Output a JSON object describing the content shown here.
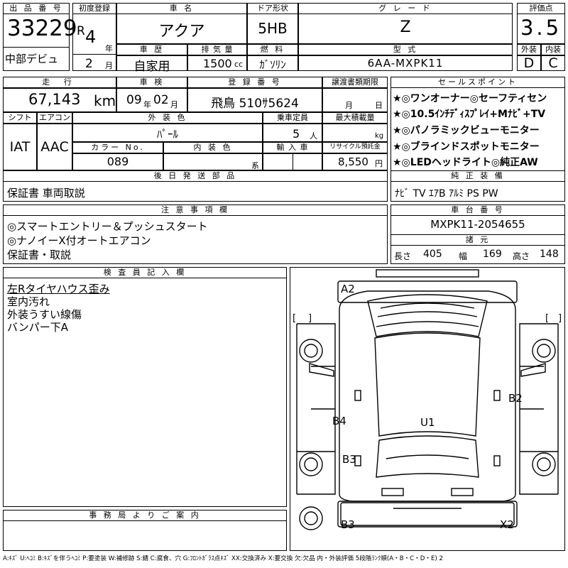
{
  "header": {
    "lot_no_label": "出 品 番 号",
    "lot_no": "33229",
    "debut_label": "中部デビュ",
    "first_reg_label": "初度登録",
    "era": "R",
    "year": "4",
    "year_unit": "年",
    "month": "2",
    "month_unit": "月",
    "car_name_label": "車   名",
    "car_name": "アクア",
    "door_label": "ドア形状",
    "door": "5HB",
    "grade_label": "グ レ ー ド",
    "grade": "Z",
    "score_label": "評価点",
    "score": "3.5",
    "history_label": "車 歴",
    "history": "自家用",
    "displacement_label": "排 気 量",
    "displacement": "1500",
    "displacement_unit": "cc",
    "fuel_label": "燃 料",
    "fuel": "ｶﾞｿﾘﾝ",
    "model_label": "型 式",
    "model": "6AA-MXPK11",
    "ext_label": "外装",
    "ext": "D",
    "int_label": "内装",
    "int": "C"
  },
  "row2": {
    "mileage_label": "走 行",
    "mileage": "67,143",
    "mileage_unit": "km",
    "inspection_label": "車 検",
    "insp_year": "09",
    "insp_year_unit": "年",
    "insp_month": "02",
    "insp_month_unit": "月",
    "reg_no_label": "登 録 番 号",
    "reg_no": "飛鳥 510ｻ5624",
    "transfer_label": "譲渡書類期限",
    "transfer_month_unit": "月",
    "transfer_day_unit": "日",
    "shift_label": "シフト",
    "shift": "IAT",
    "ac_label": "エアコン",
    "ac": "AAC",
    "ext_color_label": "外 装 色",
    "ext_color": "ﾊﾟｰﾙ",
    "capacity_label": "乗車定員",
    "capacity": "5",
    "capacity_unit": "人",
    "load_label": "最大積載量",
    "load_unit": "kg",
    "color_no_label": "カラー No.",
    "color_no": "089",
    "int_color_label": "内 装 色",
    "int_color_unit": "系",
    "import_label": "輸 入 車",
    "recycle_label": "リサイクル預託金",
    "recycle": "8,550",
    "recycle_unit": "円",
    "later_parts_label": "後 日 発 送 部 品",
    "later_parts": "保証書 車両取説"
  },
  "sales": {
    "label": "セールスポイント",
    "items": [
      "★◎ワンオーナー◎セーフティセン",
      "★◎10.5ｲﾝﾁﾃﾞｨｽﾌﾟﾚｲ+Mﾅﾋﾞ+TV",
      "★◎パノラミックビューモニター",
      "★◎ブラインドスポットモニター",
      "★◎LEDヘッドライト◎純正AW"
    ],
    "equip_label": "純 正 装 備",
    "equip": "ﾅﾋﾞ TV ｴｱB ｱﾙﾐ PS PW"
  },
  "notes": {
    "label": "注 意 事 項 欄",
    "lines": [
      "◎スマートエントリー＆プッシュスタート",
      "◎ナノイーX付オートエアコン",
      "保証書・取説"
    ]
  },
  "chassis": {
    "label": "車 台 番 号",
    "value": "MXPK11-2054655",
    "dims_label": "諸 元",
    "length_label": "長さ",
    "length": "405",
    "width_label": "幅",
    "width": "169",
    "height_label": "高さ",
    "height": "148"
  },
  "inspector": {
    "label": "検 査 員 記 入 欄",
    "lines": [
      "左Rタイヤハウス歪み",
      "室内汚れ",
      "外装うすい線傷",
      "バンパー下A"
    ]
  },
  "office": {
    "label": "事 務 局 よ り ご 案 内"
  },
  "diagram": {
    "marks": {
      "front": "A2",
      "right_side": "B2",
      "left_side": "B4",
      "roof": "U1",
      "left_rear": "B3",
      "rear_left": "B3",
      "rear_right": "X2"
    }
  },
  "legend": "A:ｷｽﾞ U:ﾍｺﾐ B:ｷｽﾞを伴うﾍｺﾐ P:要塗装 W:補修跡 S:錆 C:腐食、穴 G:ﾌﾛﾝﾄｶﾞﾗｽ点ｷｽﾞ XX:交換済み X:要交換 欠:欠品 内・外装評価 5段階ﾗﾝｸ順(A・B・C・D・E) 2"
}
